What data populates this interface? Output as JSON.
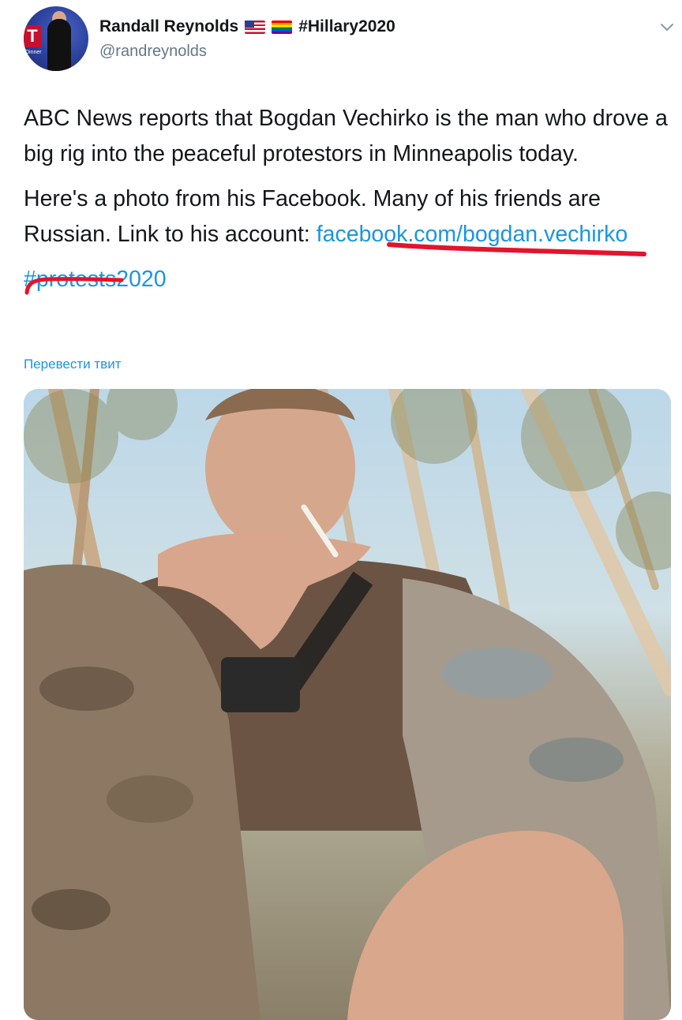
{
  "tweet": {
    "author": {
      "name": "Randall Reynolds",
      "hashtag": "#Hillary2020",
      "handle": "@randreynolds",
      "avatar_badge": "T",
      "avatar_caption": "Dinner"
    },
    "text": {
      "p1": "ABC News reports that Bogdan Vechirko is the man who drove a big rig into the peaceful protestors in Minneapolis today.",
      "p2_before_link": "Here's a photo from his Facebook. Many of his friends are Russian. Link to his account: ",
      "link": "facebook.com/bogdan.vechirko",
      "hashtag": "#protests2020"
    },
    "translate_label": "Перевести твит"
  },
  "icons": {
    "menu": "chevron-down-icon",
    "flags": [
      "us-flag-icon",
      "rainbow-flag-icon"
    ]
  },
  "colors": {
    "link": "#1b95e0",
    "handle": "#657786",
    "text": "#14171a",
    "annotation": "#e5132b"
  }
}
